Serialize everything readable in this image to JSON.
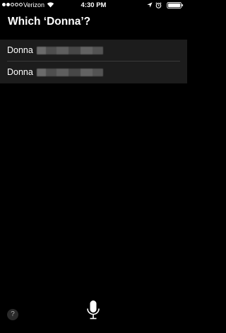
{
  "status_bar": {
    "carrier": "Verizon",
    "time": "4:30 PM",
    "signal_bars_filled": 2,
    "signal_bars_total": 5
  },
  "siri": {
    "question": "Which ‘Donna’?",
    "results": [
      {
        "first_name": "Donna",
        "last_name_obscured": true
      },
      {
        "first_name": "Donna",
        "last_name_obscured": true
      }
    ],
    "help_label": "?"
  },
  "icons": {
    "wifi": "wifi-icon",
    "location": "location-arrow-icon",
    "alarm": "alarm-clock-icon",
    "battery": "battery-icon",
    "mic": "microphone-icon",
    "help": "help-icon"
  }
}
